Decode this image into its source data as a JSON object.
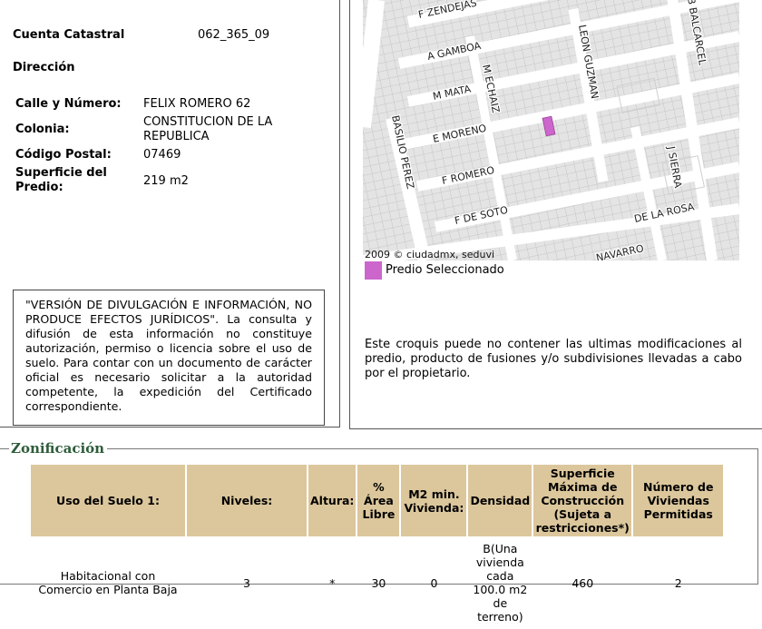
{
  "cuenta": {
    "label": "Cuenta Catastral",
    "value": "062_365_09"
  },
  "direccion": {
    "heading": "Dirección",
    "calle_label": "Calle y Número:",
    "calle_value": "FELIX ROMERO 62",
    "colonia_label": "Colonia:",
    "colonia_value": "CONSTITUCION DE LA REPUBLICA",
    "cp_label": "Código Postal:",
    "cp_value": "07469",
    "superficie_label": "Superficie del Predio:",
    "superficie_value": "219 m2"
  },
  "disclaimer": "\"VERSIÓN DE DIVULGACIÓN E INFORMACIÓN, NO PRODUCE EFECTOS JURÍDICOS\". La consulta y difusión de esta información no constituye autorización, permiso o licencia sobre el uso de suelo. Para contar con un documento de carácter oficial es necesario solicitar a la autoridad competente, la expedición del Certificado correspondiente.",
  "map": {
    "streets": {
      "zendejas": "F ZENDEJAS",
      "gamboa": "A GAMBOA",
      "mata": "M MATA",
      "moreno": "E MORENO",
      "romero": "F ROMERO",
      "soto": "F DE SOTO",
      "echaiz": "M ECHAIZ",
      "guzman": "LEON GUZMAN",
      "balcarcel": "B BALCARCEL",
      "perez": "BASILIO PEREZ",
      "sierra": "J SIERRA",
      "rosa": "DE LA ROSA",
      "navarro": "NAVARRO"
    },
    "copyright": "2009 © ciudadmx, seduvi",
    "highlight_color": "#cc66cc"
  },
  "legend": {
    "label": "Predio Seleccionado",
    "color": "#cc66cc"
  },
  "croquis_note": "Este croquis puede no contener las ultimas modificaciones al predio, producto de fusiones y/o subdivisiones llevadas a cabo por el propietario.",
  "zonificacion": {
    "title": "Zonificación",
    "headers": {
      "uso": "Uso del Suelo 1:",
      "niveles": "Niveles:",
      "altura": "Altura:",
      "area_libre": "% Área Libre",
      "m2_min": "M2 min. Vivienda:",
      "densidad": "Densidad",
      "superficie_max": "Superficie Máxima de Construcción (Sujeta a restricciones*)",
      "num_viviendas": "Número de Viviendas Permitidas"
    },
    "row": {
      "uso": "Habitacional con Comercio en Planta Baja",
      "niveles": "3",
      "altura": "*",
      "area_libre": "30",
      "m2_min": "0",
      "densidad": "B(Una vivienda cada 100.0 m2 de terreno)",
      "superficie_max": "460",
      "num_viviendas": "2"
    }
  }
}
